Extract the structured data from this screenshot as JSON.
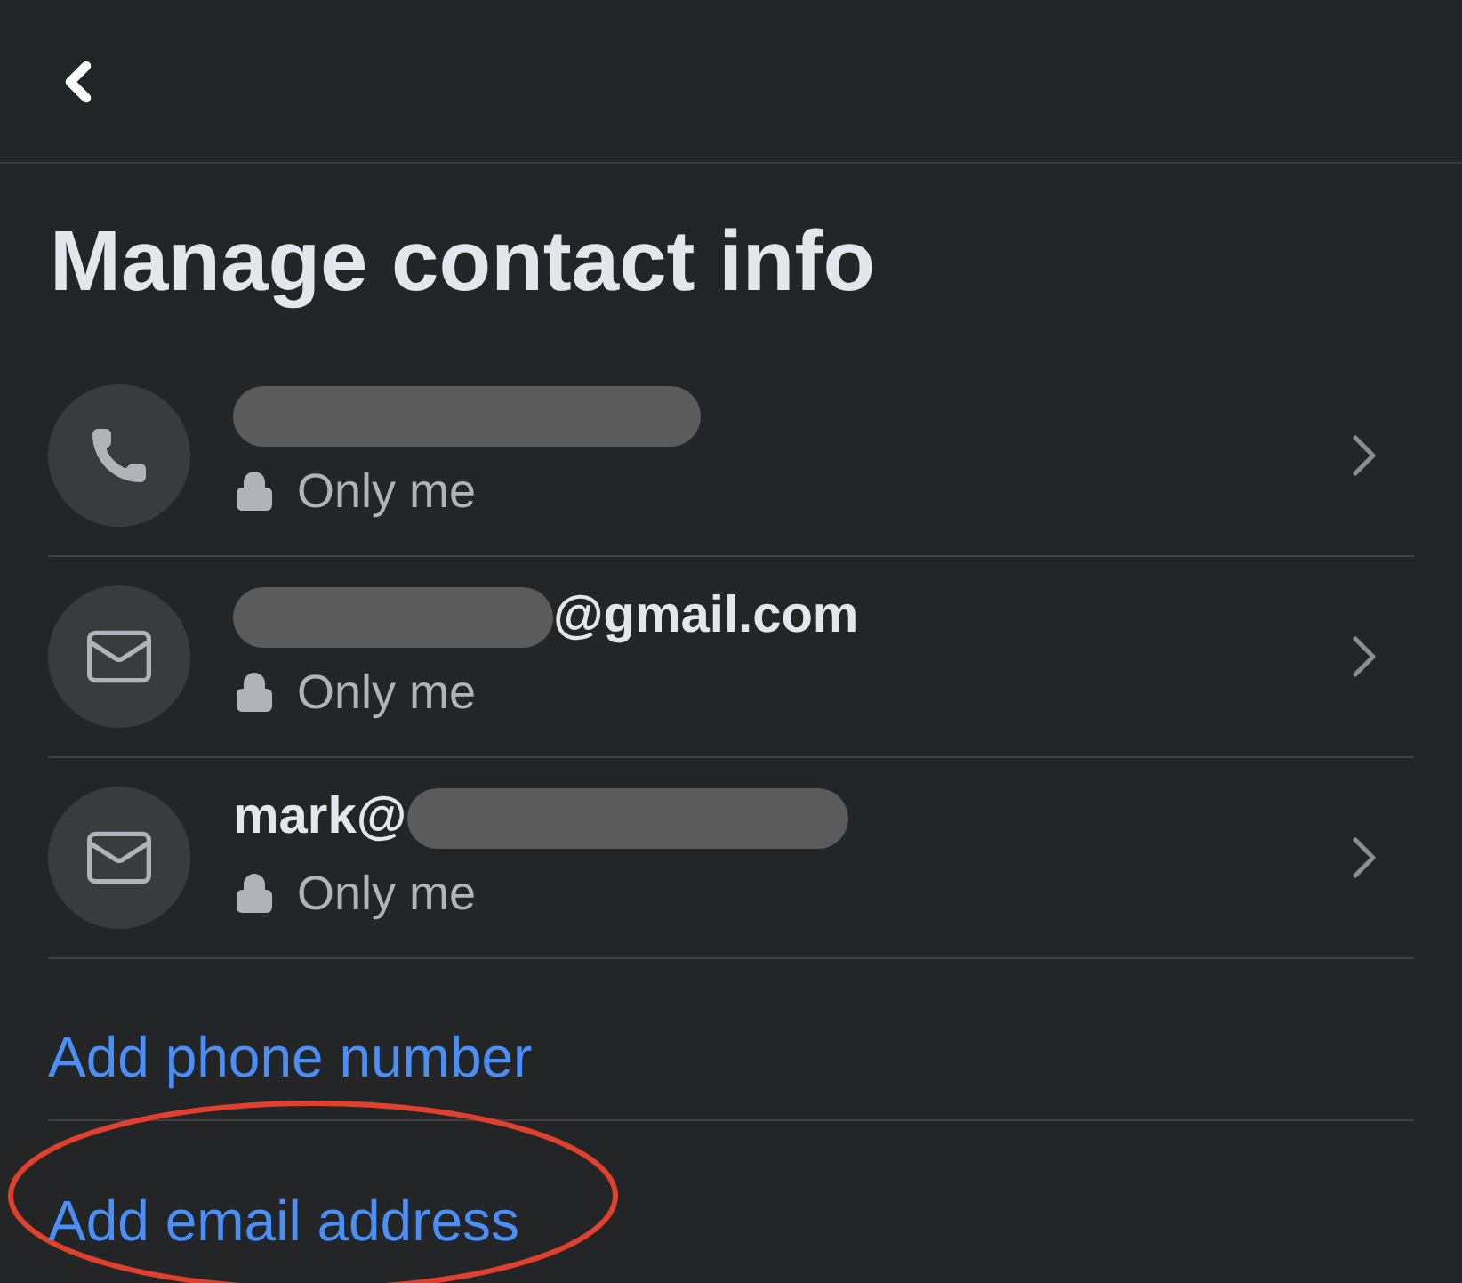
{
  "title": "Manage contact info",
  "contacts": [
    {
      "kind": "phone",
      "segments": [
        {
          "kind": "redacted"
        }
      ],
      "privacy": "Only me"
    },
    {
      "kind": "email",
      "segments": [
        {
          "kind": "redacted"
        },
        {
          "kind": "text",
          "text": "@gmail.com"
        }
      ],
      "privacy": "Only me"
    },
    {
      "kind": "email",
      "segments": [
        {
          "kind": "text",
          "text": "mark@"
        },
        {
          "kind": "redacted"
        }
      ],
      "privacy": "Only me"
    }
  ],
  "actions": [
    {
      "label": "Add phone number",
      "highlighted": false
    },
    {
      "label": "Add email address",
      "highlighted": true
    }
  ]
}
